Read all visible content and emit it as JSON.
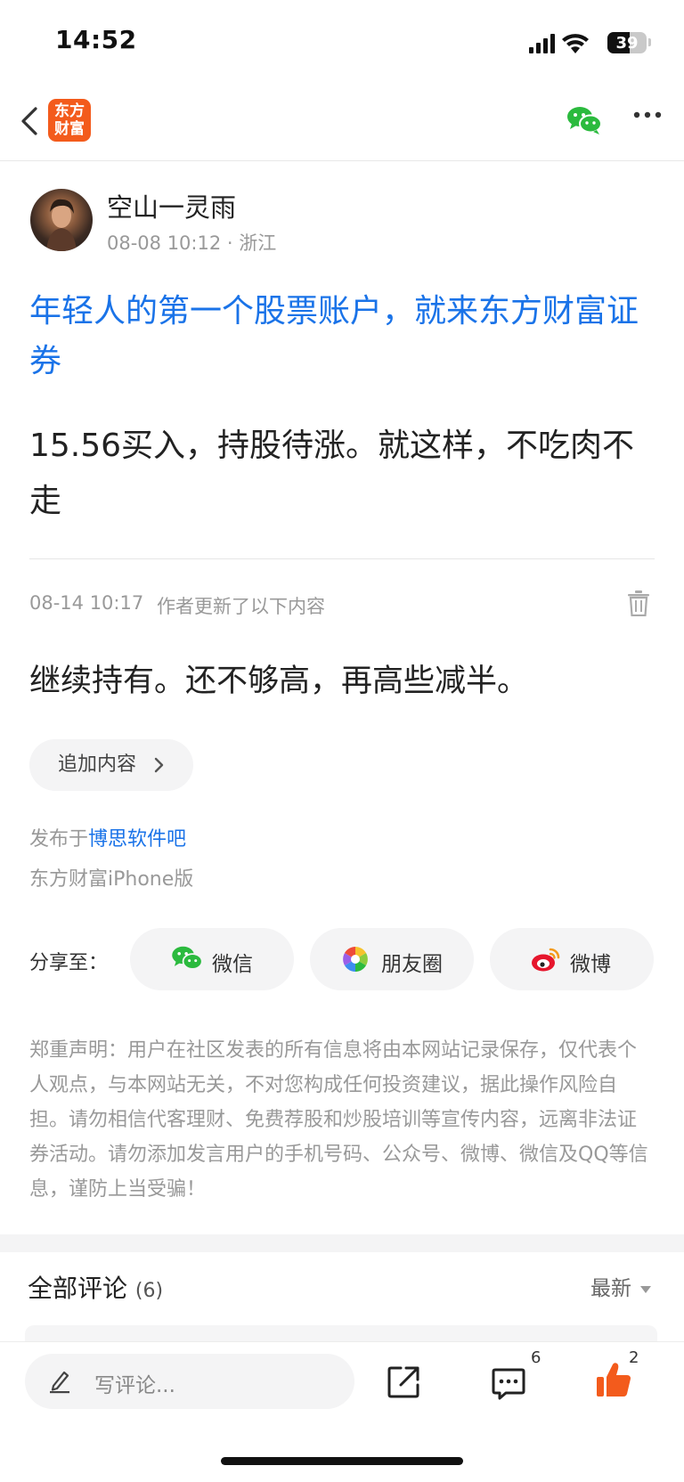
{
  "status_bar": {
    "time": "14:52",
    "battery": "39"
  },
  "nav": {
    "logo_line1": "东方",
    "logo_line2": "财富"
  },
  "post": {
    "author": "空山一灵雨",
    "meta": "08-08 10:12 · 浙江",
    "title": "年轻人的第一个股票账户，就来东方财富证券",
    "body": "15.56买入，持股待涨。就这样，不吃肉不走",
    "update_time": "08-14 10:17",
    "update_note": "作者更新了以下内容",
    "update_body": "继续持有。还不够高，再高些减半。",
    "add_content_label": "追加内容",
    "published_prefix": "发布于",
    "forum_name": "博思软件吧",
    "device": "东方财富iPhone版"
  },
  "share": {
    "label": "分享至：",
    "buttons": [
      {
        "label": "微信",
        "icon": "wechat-icon"
      },
      {
        "label": "朋友圈",
        "icon": "moments-icon"
      },
      {
        "label": "微博",
        "icon": "weibo-icon"
      }
    ]
  },
  "disclaimer": "郑重声明：用户在社区发表的所有信息将由本网站记录保存，仅代表个人观点，与本网站无关，不对您构成任何投资建议，据此操作风险自担。请勿相信代客理财、免费荐股和炒股培训等宣传内容，远离非法证券活动。请勿添加发言用户的手机号码、公众号、微博、微信及QQ等信息，谨防上当受骗！",
  "comments": {
    "title": "全部评论",
    "count": "(6)",
    "sort": "最新"
  },
  "bottom_bar": {
    "placeholder": "写评论...",
    "comment_count": "6",
    "like_count": "2"
  },
  "colors": {
    "brand": "#f35b1c",
    "link": "#1a73e8",
    "wechat": "#2bba3e"
  }
}
